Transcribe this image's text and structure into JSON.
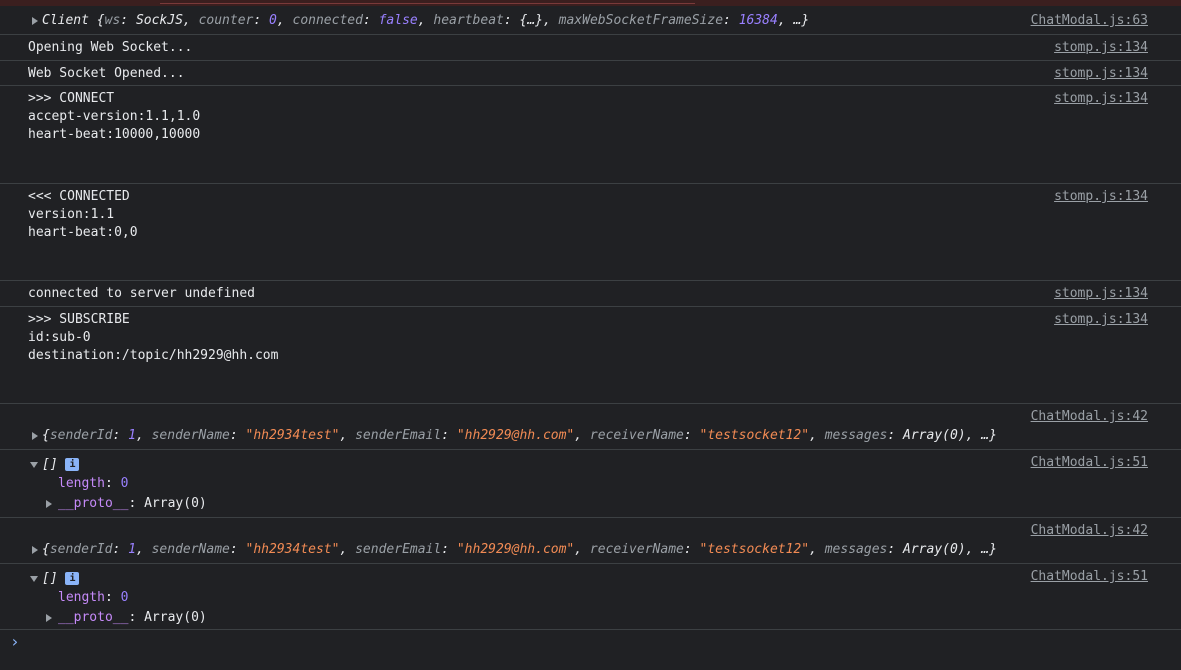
{
  "rows": {
    "r1": {
      "src": "ChatModal.js:63",
      "label": "Client",
      "obj": {
        "k1": "ws",
        "v1": "SockJS",
        "k2": "counter",
        "v2": "0",
        "k3": "connected",
        "v3": "false",
        "k4": "heartbeat",
        "v4": "{…}",
        "k5": "maxWebSocketFrameSize",
        "v5": "16384",
        "more": "…"
      }
    },
    "r2": {
      "msg": "Opening Web Socket...",
      "src": "stomp.js:134"
    },
    "r3": {
      "msg": "Web Socket Opened...",
      "src": "stomp.js:134"
    },
    "r4": {
      "msg": ">>> CONNECT\naccept-version:1.1,1.0\nheart-beat:10000,10000",
      "src": "stomp.js:134"
    },
    "r5": {
      "msg": "<<< CONNECTED\nversion:1.1\nheart-beat:0,0",
      "src": "stomp.js:134"
    },
    "r6": {
      "msg": "connected to server undefined",
      "src": "stomp.js:134"
    },
    "r7": {
      "msg": ">>> SUBSCRIBE\nid:sub-0\ndestination:/topic/hh2929@hh.com",
      "src": "stomp.js:134"
    },
    "r8": {
      "src": "ChatModal.js:42",
      "obj": {
        "k1": "senderId",
        "v1": "1",
        "k2": "senderName",
        "v2": "\"hh2934test\"",
        "k3": "senderEmail",
        "v3": "\"hh2929@hh.com\"",
        "k4": "receiverName",
        "v4": "\"testsocket12\"",
        "k5": "messages",
        "v5": "Array(0)",
        "more": "…"
      }
    },
    "r9": {
      "src": "ChatModal.js:51",
      "label": "[]",
      "info": "i",
      "length_key": "length",
      "length_val": "0",
      "proto_key": "__proto__",
      "proto_val": "Array(0)"
    },
    "r10": {
      "src": "ChatModal.js:42",
      "obj": {
        "k1": "senderId",
        "v1": "1",
        "k2": "senderName",
        "v2": "\"hh2934test\"",
        "k3": "senderEmail",
        "v3": "\"hh2929@hh.com\"",
        "k4": "receiverName",
        "v4": "\"testsocket12\"",
        "k5": "messages",
        "v5": "Array(0)",
        "more": "…"
      }
    },
    "r11": {
      "src": "ChatModal.js:51",
      "label": "[]",
      "info": "i",
      "length_key": "length",
      "length_val": "0",
      "proto_key": "__proto__",
      "proto_val": "Array(0)"
    }
  },
  "prompt": "›"
}
